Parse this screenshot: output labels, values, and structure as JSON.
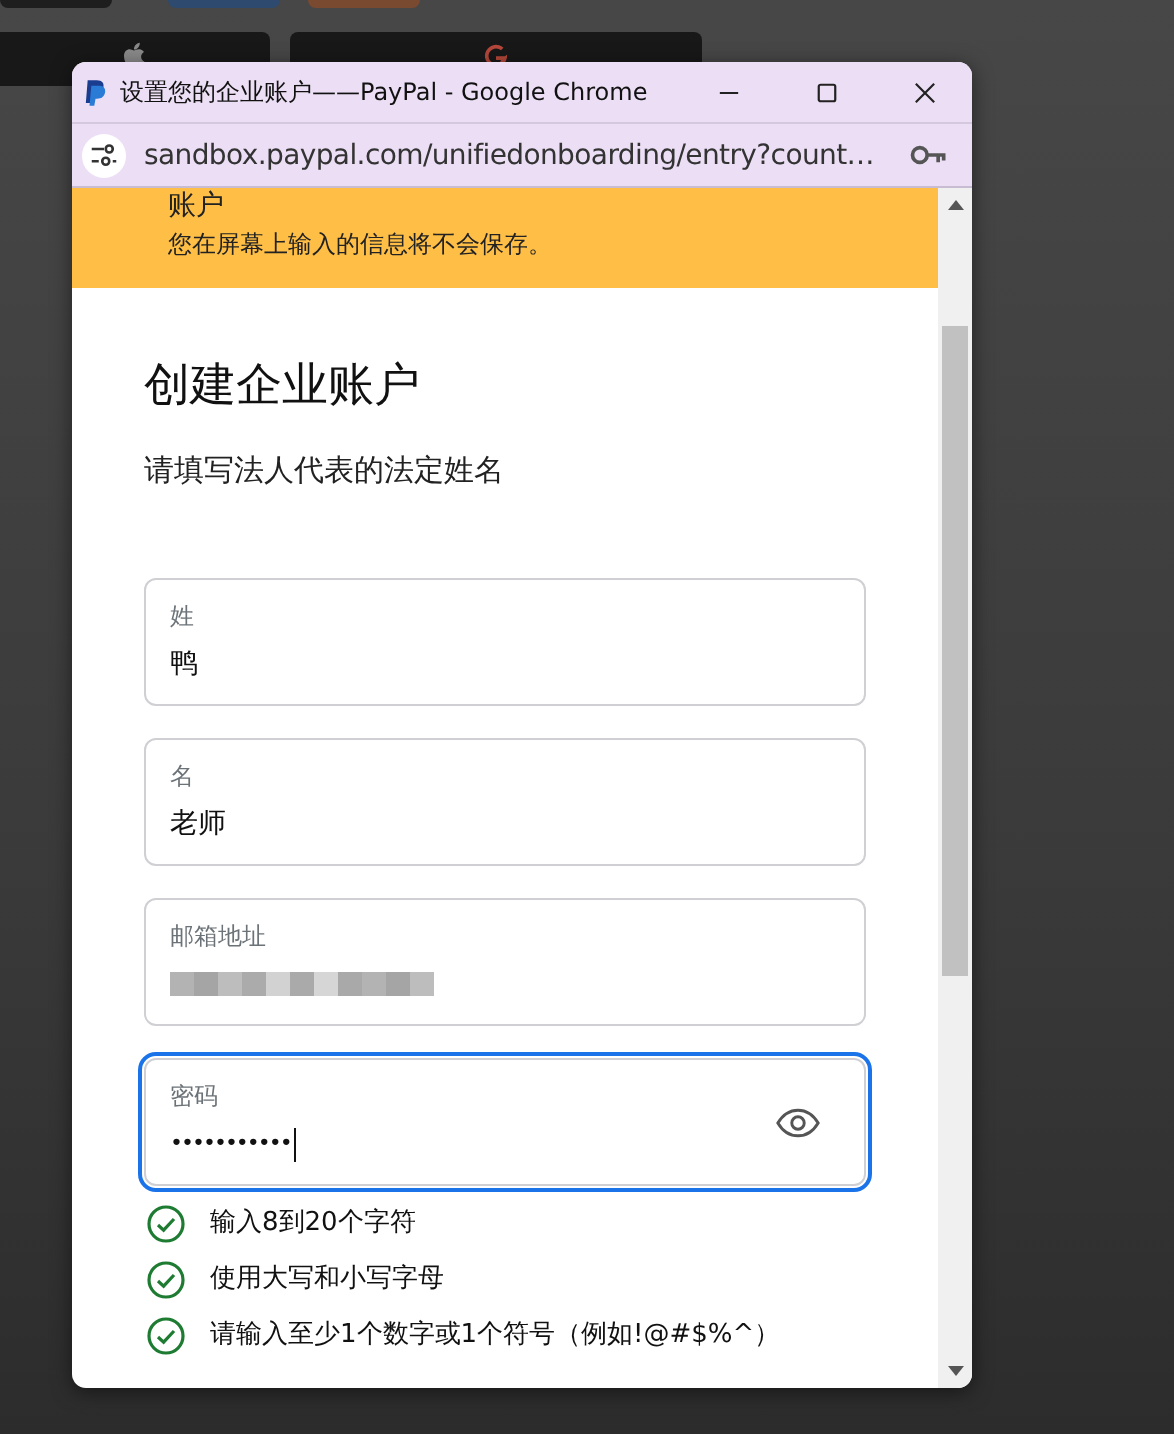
{
  "background_buttons": [
    {
      "kind": "apple"
    },
    {
      "kind": "google"
    }
  ],
  "window": {
    "title": "设置您的企业账户——PayPal - Google Chrome",
    "url": "sandbox.paypal.com/unifiedonboarding/entry?count…"
  },
  "banner": {
    "title": "账户",
    "message": "您在屏幕上输入的信息将不会保存。"
  },
  "heading": "创建企业账户",
  "subheading": "请填写法人代表的法定姓名",
  "fields": [
    {
      "label": "姓",
      "value": "鸭",
      "kind": "text",
      "focused": false
    },
    {
      "label": "名",
      "value": "老师",
      "kind": "text",
      "focused": false
    },
    {
      "label": "邮箱地址",
      "kind": "redacted",
      "focused": false
    },
    {
      "label": "密码",
      "value": "•••••••••••",
      "kind": "password",
      "focused": true
    }
  ],
  "requirements": [
    {
      "text": "输入8到20个字符",
      "met": true
    },
    {
      "text": "使用大写和小写字母",
      "met": true
    },
    {
      "text": "请输入至少1个数字或1个符号（例如!@#$%^）",
      "met": true
    }
  ]
}
